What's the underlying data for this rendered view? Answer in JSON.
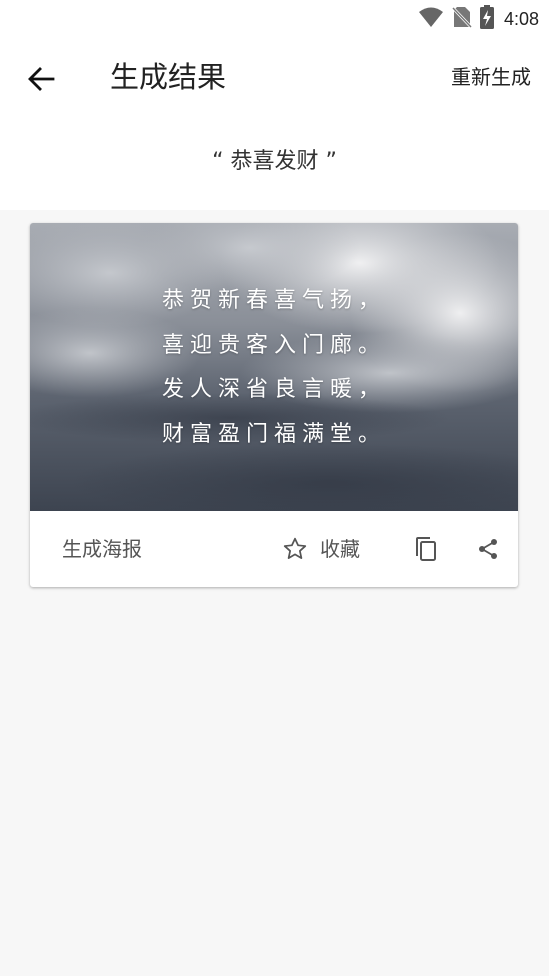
{
  "status_bar": {
    "time": "4:08",
    "icons": [
      "wifi-icon",
      "no-sim-icon",
      "battery-charging-icon"
    ]
  },
  "app_bar": {
    "back_icon": "arrow-left-icon",
    "title": "生成结果",
    "regenerate_label": "重新生成"
  },
  "keyword": {
    "text": "“  恭喜发财  ”"
  },
  "card": {
    "poem_lines": [
      "恭贺新春喜气扬，",
      "喜迎贵客入门廊。",
      "发人深省良言暖，",
      "财富盈门福满堂。"
    ],
    "actions": {
      "poster_label": "生成海报",
      "favorite_label": "收藏",
      "favorite_icon": "star-outline-icon",
      "copy_icon": "copy-icon",
      "share_icon": "share-icon"
    }
  },
  "colors": {
    "background": "#f7f7f7",
    "surface": "#ffffff",
    "text_primary": "#222222",
    "text_secondary": "#555555",
    "poem_text": "#ffffff"
  }
}
